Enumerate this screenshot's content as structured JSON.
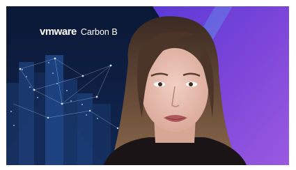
{
  "video": {
    "background_brand": {
      "logo_text": "vmware",
      "product_text": "Carbon B"
    },
    "scene": {
      "subject": "presenter-on-camera",
      "backdrop": "city-skyline-with-network-overlay",
      "accent_colors": [
        "#0c1b3a",
        "#3b6fd8",
        "#7a3fc9",
        "#9b55e0"
      ]
    }
  }
}
